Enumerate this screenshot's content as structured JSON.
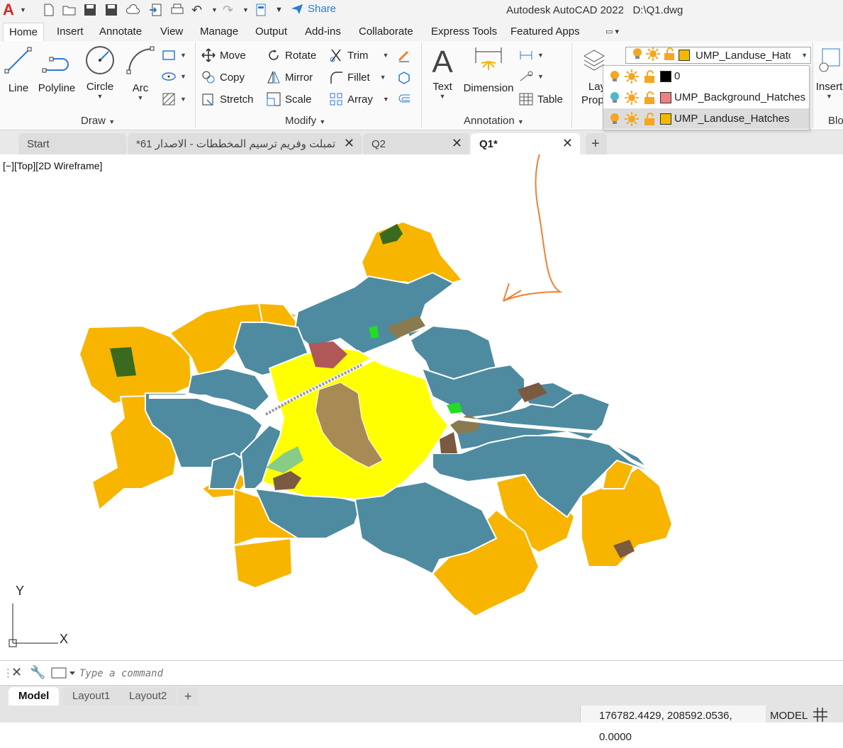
{
  "app": {
    "title": "Autodesk AutoCAD 2022",
    "file": "D:\\Q1.dwg",
    "share_label": "Share"
  },
  "ribbon_tabs": [
    "Home",
    "Insert",
    "Annotate",
    "View",
    "Manage",
    "Output",
    "Add-ins",
    "Collaborate",
    "Express Tools",
    "Featured Apps"
  ],
  "draw": {
    "title": "Draw",
    "line": "Line",
    "polyline": "Polyline",
    "circle": "Circle",
    "arc": "Arc"
  },
  "modify": {
    "title": "Modify",
    "move": "Move",
    "rotate": "Rotate",
    "trim": "Trim",
    "copy": "Copy",
    "mirror": "Mirror",
    "fillet": "Fillet",
    "stretch": "Stretch",
    "scale": "Scale",
    "array": "Array"
  },
  "annotation": {
    "title": "Annotation",
    "text": "Text",
    "dimension": "Dimension",
    "table": "Table"
  },
  "layers": {
    "props_label_1": "Lay",
    "props_label_2": "Prope",
    "current": "UMP_Landuse_Hatcl",
    "current_color": "#f5b800",
    "list": [
      {
        "name": "0",
        "color": "#000000",
        "bulb": "#f5a623"
      },
      {
        "name": "UMP_Background_Hatches",
        "color": "#f08080",
        "bulb": "#4fb8c8"
      },
      {
        "name": "UMP_Landuse_Hatches",
        "color": "#f5b800",
        "bulb": "#f5a623"
      }
    ]
  },
  "insert": {
    "label": "Insert",
    "blo": "Blo"
  },
  "file_tabs": [
    {
      "label": "Start"
    },
    {
      "label": "تمبلت وفريم ترسيم المخططات - الاصدار 61*"
    },
    {
      "label": "Q2"
    },
    {
      "label": "Q1*"
    }
  ],
  "viewport_label": "[−][Top][2D Wireframe]",
  "ucs": {
    "x": "X",
    "y": "Y"
  },
  "command": {
    "placeholder": "Type a command"
  },
  "layout_tabs": [
    "Model",
    "Layout1",
    "Layout2"
  ],
  "status": {
    "coords": "176782.4429, 208592.0536, 0.0000",
    "model": "MODEL"
  },
  "colors": {
    "blue_zone": "#4e8ba0",
    "orange_zone": "#f7b500",
    "yellow_zone": "#ffff00",
    "brown_zone": "#a88a55",
    "arrow": "#f08030"
  }
}
